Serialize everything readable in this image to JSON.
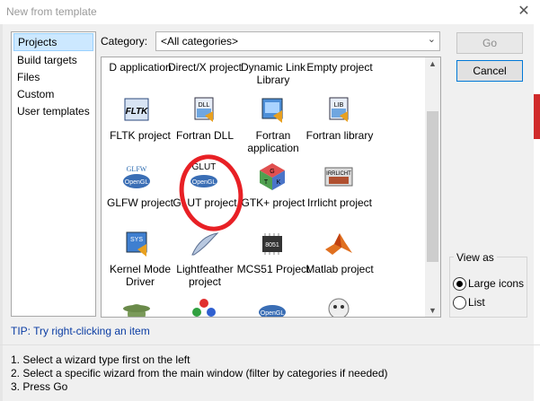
{
  "window": {
    "title": "New from template",
    "close_glyph": "✕"
  },
  "sidebar": {
    "items": [
      "Projects",
      "Build targets",
      "Files",
      "Custom",
      "User templates"
    ],
    "selected": "Projects"
  },
  "category": {
    "label": "Category:",
    "value": "<All categories>"
  },
  "buttons": {
    "go": "Go",
    "cancel": "Cancel"
  },
  "templates": [
    {
      "label": "D application",
      "icon": "d-application-icon"
    },
    {
      "label": "Direct/X project",
      "icon": "directx-icon"
    },
    {
      "label": "Dynamic Link Library",
      "icon": "dll-icon"
    },
    {
      "label": "Empty project",
      "icon": "empty-project-icon"
    },
    {
      "label": "FLTK project",
      "icon": "fltk-icon",
      "badge": "FLTK"
    },
    {
      "label": "Fortran DLL",
      "icon": "fortran-dll-icon",
      "badge": "DLL"
    },
    {
      "label": "Fortran application",
      "icon": "fortran-application-icon"
    },
    {
      "label": "Fortran library",
      "icon": "fortran-library-icon",
      "badge": "LIB"
    },
    {
      "label": "GLFW project",
      "icon": "glfw-icon",
      "badge": "GLFW",
      "badge2": "OpenGL"
    },
    {
      "label": "GLUT project",
      "icon": "glut-icon",
      "badge": "GLUT",
      "badge2": "OpenGL"
    },
    {
      "label": "GTK+ project",
      "icon": "gtk-icon"
    },
    {
      "label": "Irrlicht project",
      "icon": "irrlicht-icon",
      "badge": "IRRLICHT"
    },
    {
      "label": "Kernel Mode Driver",
      "icon": "kernel-driver-icon",
      "badge": "SYS"
    },
    {
      "label": "Lightfeather project",
      "icon": "lightfeather-icon"
    },
    {
      "label": "MCS51 Project",
      "icon": "mcs51-icon",
      "badge": "8051"
    },
    {
      "label": "Matlab project",
      "icon": "matlab-icon"
    },
    {
      "label": "",
      "icon": "yoda-icon"
    },
    {
      "label": "",
      "icon": "colored-shapes-icon"
    },
    {
      "label": "",
      "icon": "opengl-icon",
      "badge": "OpenGL"
    },
    {
      "label": "",
      "icon": "mascot-icon"
    }
  ],
  "view_as": {
    "label": "View as",
    "options": [
      "Large icons",
      "List"
    ],
    "selected": "Large icons"
  },
  "tip": "TIP: Try right-clicking an item",
  "instructions": [
    "1. Select a wizard type first on the left",
    "2. Select a specific wizard from the main window (filter by categories if needed)",
    "3. Press Go"
  ],
  "colors": {
    "tip": "#0a3ca3",
    "annotation": "#e82025",
    "selection": "#cce8ff"
  }
}
